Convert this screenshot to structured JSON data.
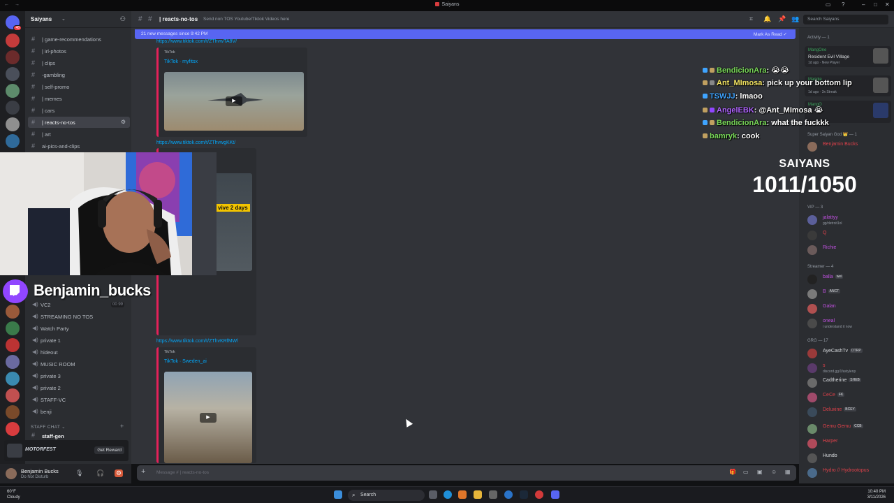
{
  "window": {
    "title": "Saiyans"
  },
  "server": {
    "name": "Saiyans"
  },
  "channels": [
    {
      "label": "| game-recommendations"
    },
    {
      "label": "| irl-photos"
    },
    {
      "label": "| clips"
    },
    {
      "label": "-gambling"
    },
    {
      "label": "| self-promo"
    },
    {
      "label": "| memes"
    },
    {
      "label": "| cars"
    },
    {
      "label": "| reacts-no-tos"
    },
    {
      "label": "| art"
    },
    {
      "label": "ai-pics-and-clips"
    }
  ],
  "voice_channels": [
    {
      "label": "VC2",
      "count": "00 99"
    },
    {
      "label": "STREAMING NO TOS"
    },
    {
      "label": "Watch Party"
    },
    {
      "label": "private 1"
    },
    {
      "label": "hideout"
    },
    {
      "label": "MUSIC ROOM"
    },
    {
      "label": "private 3"
    },
    {
      "label": "private 2"
    },
    {
      "label": "STAFF-VC"
    },
    {
      "label": "benji"
    }
  ],
  "staff_category": "STAFF CHAT",
  "staff_channel": "staff-gen",
  "promo": {
    "brand": "MOTORFEST",
    "button": "Get Reward"
  },
  "user": {
    "name": "Benjamin Bucks",
    "status": "Do Not Disturb"
  },
  "channel_header": {
    "name": "| reacts-no-tos",
    "topic": "Send non TOS Youtube/Tiktok Videos here"
  },
  "search": {
    "placeholder": "Search Saiyans"
  },
  "new_messages": {
    "text": "21 new messages since 9:42 PM",
    "action": "Mark As Read"
  },
  "messages": [
    {
      "link": "https://www.tiktok.com/t/ZThvwTA8V/",
      "provider": "TikTok",
      "title": "TikTok · myfitsx"
    },
    {
      "link": "https://www.tiktok.com/t/ZThvwgKKt/",
      "caption": "vive 2 days"
    },
    {
      "link": "https://www.tiktok.com/t/ZThvKRfMW/",
      "provider": "TikTok",
      "title": "TikTok · Sweden_ai"
    }
  ],
  "composer": {
    "placeholder": "Message # | reacts-no-tos"
  },
  "overlay_chat": [
    {
      "user": "BendicionAra",
      "text": "😭😭",
      "color": "#7ad95a"
    },
    {
      "user": "Ant_MImosa",
      "text": "pick up your bottom lip",
      "color": "#f5e663"
    },
    {
      "user": "TSWJJ",
      "text": "lmaoo",
      "color": "#3fa4ff"
    },
    {
      "user": "AngelEBK",
      "text": "@Ant_MImosa 😭",
      "color": "#b065ff"
    },
    {
      "user": "BendicionAra",
      "text": "what the fuckkk",
      "color": "#7ad95a"
    },
    {
      "user": "bamryk",
      "text": "cook",
      "color": "#7ad95a"
    }
  ],
  "goal": {
    "title": "SAIYANS",
    "count": "1011/1050"
  },
  "activity": {
    "label": "Activity — 1",
    "cards": [
      {
        "name": "MangOne",
        "game": "Resident Evil Village",
        "sub": "1d ago · New Player"
      },
      {
        "name": "Mangle",
        "game": "",
        "sub": "1d ago · 3x Streak"
      },
      {
        "name": "MangO",
        "game": "",
        "sub": ""
      }
    ]
  },
  "member_groups": [
    {
      "label": "Super Saiyan God 👑 — 1",
      "members": [
        {
          "name": "Benjamin Bucks",
          "color": "#e0414a"
        }
      ]
    },
    {
      "label": "VIP — 3",
      "members": [
        {
          "name": "jalattyy",
          "sub": "gg/detroit1ol",
          "color": "#c050e0"
        },
        {
          "name": "Q",
          "color": "#e0414a"
        },
        {
          "name": "Richie",
          "color": "#c050e0"
        }
      ]
    },
    {
      "label": "Streamer — 4",
      "members": [
        {
          "name": "balla",
          "tag": "wei",
          "color": "#c050e0"
        },
        {
          "name": "B",
          "tag": "ANCT",
          "color": "#c050e0"
        },
        {
          "name": "Galan",
          "color": "#c050e0"
        },
        {
          "name": "oneal",
          "sub": "i understand it now",
          "color": "#c050e0"
        }
      ]
    },
    {
      "label": "GRG — 17",
      "members": [
        {
          "name": "AyeCashTv",
          "tag": "DTRP",
          "color": "#dbdee1"
        },
        {
          "name": "s",
          "sub": "discord.gg/1fastylenp",
          "color": "#e0414a"
        },
        {
          "name": "Cadtherine",
          "tag": "SHEB",
          "color": "#dbdee1"
        },
        {
          "name": "CeCe",
          "tag": "FK",
          "color": "#e0414a"
        },
        {
          "name": "Deluxine",
          "tag": "BCEY",
          "color": "#e0414a"
        },
        {
          "name": "Gemu Gemu",
          "tag": "CCB",
          "color": "#e0414a"
        },
        {
          "name": "Harper",
          "color": "#e0414a"
        },
        {
          "name": "Hundo",
          "color": "#dbdee1"
        },
        {
          "name": "Hydro // Hydrootopus",
          "color": "#e0414a"
        }
      ]
    }
  ],
  "twitch": {
    "name": "Benjamin_bucks"
  },
  "taskbar": {
    "weather_temp": "60°F",
    "weather_desc": "Cloudy",
    "search": "Search",
    "time": "10:40 PM",
    "date": "3/11/2026"
  }
}
